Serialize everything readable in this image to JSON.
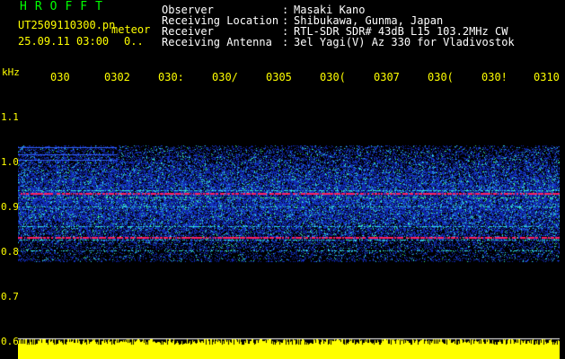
{
  "header": {
    "app_title": "HROFFT",
    "file_name": "UT2509110300.pn",
    "file_ext_label": "meteor",
    "date_time": "25.09.11 03:00",
    "date_suffix": "0.."
  },
  "metadata": [
    {
      "key": "Observer",
      "value": "Masaki Kano"
    },
    {
      "key": "Receiving Location",
      "value": "Shibukawa, Gunma, Japan"
    },
    {
      "key": "Receiver",
      "value": "RTL-SDR SDR# 43dB L15 103.2MHz CW"
    },
    {
      "key": "Receiving Antenna",
      "value": "3el Yagi(V) Az 330 for Vladivostok"
    }
  ],
  "axis": {
    "unit": "kHz",
    "y_ticks": [
      "1.1",
      "1.0",
      "0.9",
      "0.8",
      "0.7",
      "0.6"
    ],
    "x_ticks": [
      "030",
      "0302",
      "030:",
      "030/",
      "0305",
      "030(",
      "0307",
      "030(",
      "030!",
      "0310"
    ]
  },
  "colors": {
    "background": "#000000",
    "header_green": "#00ff00",
    "label_yellow": "#ffff00",
    "noise_blue": "#1030c0",
    "signal_cyan": "#30e0e0",
    "signal_red": "#ff2060",
    "level_yellow": "#ffff00"
  }
}
